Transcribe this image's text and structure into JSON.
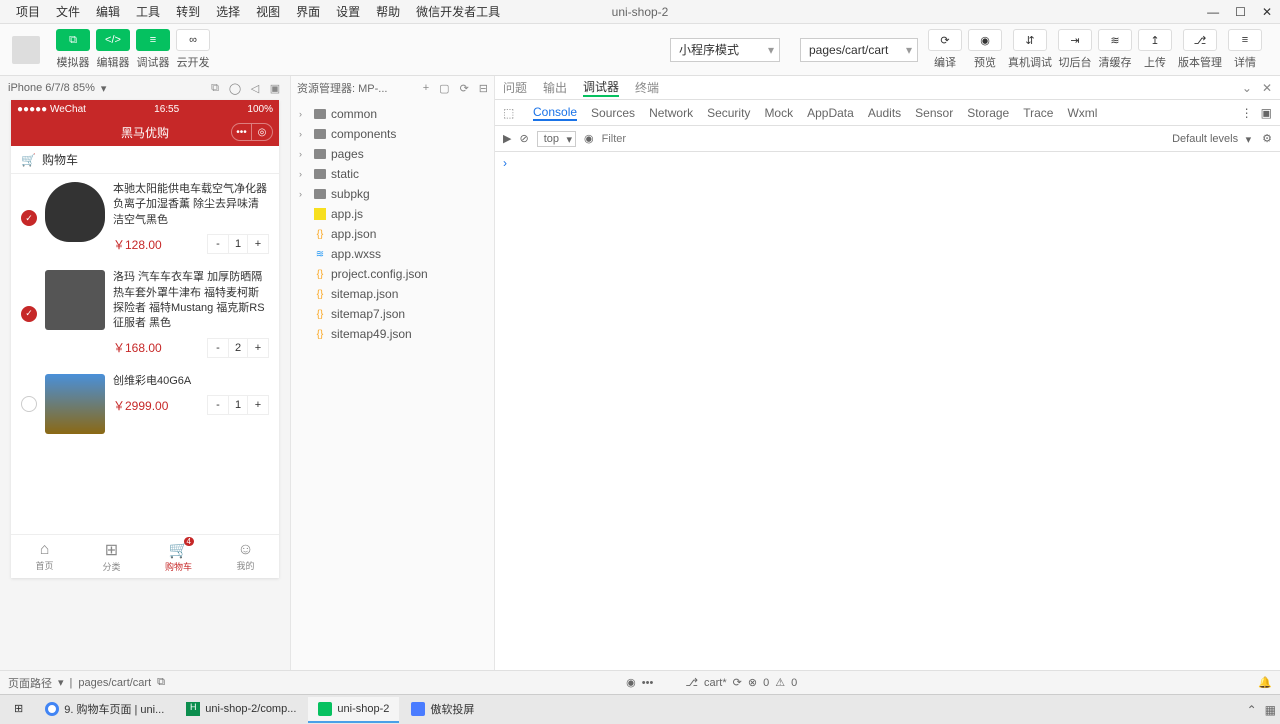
{
  "window": {
    "title": "uni-shop-2",
    "menu": [
      "项目",
      "文件",
      "编辑",
      "工具",
      "转到",
      "选择",
      "视图",
      "界面",
      "设置",
      "帮助",
      "微信开发者工具"
    ]
  },
  "toolbar": {
    "buttons": [
      {
        "label": "模拟器",
        "glyph": "⧉"
      },
      {
        "label": "编辑器",
        "glyph": "</>"
      },
      {
        "label": "调试器",
        "glyph": "≡"
      },
      {
        "label": "云开发",
        "glyph": "∞"
      }
    ],
    "mode_select": "小程序模式",
    "page_select": "pages/cart/cart",
    "actions": [
      {
        "label": "编译",
        "glyph": "⟳"
      },
      {
        "label": "预览",
        "glyph": "◉"
      },
      {
        "label": "真机调试",
        "glyph": "⇵"
      },
      {
        "label": "切后台",
        "glyph": "⇥"
      },
      {
        "label": "清缓存",
        "glyph": "≋"
      }
    ],
    "right_actions": [
      {
        "label": "上传",
        "glyph": "↥"
      },
      {
        "label": "版本管理",
        "glyph": "⎇"
      },
      {
        "label": "详情",
        "glyph": "≡"
      }
    ]
  },
  "simulator": {
    "device": "iPhone 6/7/8 85%",
    "status": {
      "left": "●●●●● WeChat",
      "time": "16:55",
      "right": "100%"
    },
    "nav_title": "黑马优购",
    "cart_header": "购物车",
    "items": [
      {
        "checked": true,
        "name": "本驰太阳能供电车载空气净化器负离子加湿香薰 除尘去异味清洁空气黑色",
        "price": "￥128.00",
        "qty": "1"
      },
      {
        "checked": true,
        "name": "洛玛 汽车车衣车罩 加厚防晒隔热车套外罩牛津布 福特麦柯斯 探险者 福特Mustang 福克斯RS 征服者 黑色",
        "price": "￥168.00",
        "qty": "2"
      },
      {
        "checked": false,
        "name": "创维彩电40G6A",
        "price": "￥2999.00",
        "qty": "1"
      }
    ],
    "tabs": [
      {
        "label": "首页",
        "glyph": "⌂"
      },
      {
        "label": "分类",
        "glyph": "⊞"
      },
      {
        "label": "购物车",
        "glyph": "🛒",
        "badge": "4",
        "active": true
      },
      {
        "label": "我的",
        "glyph": "☺"
      }
    ]
  },
  "explorer": {
    "title": "资源管理器: MP-...",
    "folders": [
      "common",
      "components",
      "pages",
      "static",
      "subpkg"
    ],
    "files": [
      {
        "name": "app.js",
        "type": "js"
      },
      {
        "name": "app.json",
        "type": "json"
      },
      {
        "name": "app.wxss",
        "type": "wxss"
      },
      {
        "name": "project.config.json",
        "type": "json"
      },
      {
        "name": "sitemap.json",
        "type": "json"
      },
      {
        "name": "sitemap7.json",
        "type": "json"
      },
      {
        "name": "sitemap49.json",
        "type": "json"
      }
    ]
  },
  "devtools": {
    "tabs1": [
      "问题",
      "输出",
      "调试器",
      "终端"
    ],
    "tabs1_active": 2,
    "tabs2": [
      "Console",
      "Sources",
      "Network",
      "Security",
      "Mock",
      "AppData",
      "Audits",
      "Sensor",
      "Storage",
      "Trace",
      "Wxml"
    ],
    "tabs2_active": 0,
    "context": "top",
    "filter_placeholder": "Filter",
    "levels": "Default levels",
    "prompt": "›"
  },
  "statusbar": {
    "left": "页面路径",
    "path": "pages/cart/cart",
    "branch": "cart*",
    "errors": "0",
    "warnings": "0"
  },
  "taskbar": {
    "items": [
      {
        "label": "9. 购物车页面 | uni..."
      },
      {
        "label": "uni-shop-2/comp..."
      },
      {
        "label": "uni-shop-2",
        "active": true
      },
      {
        "label": "傲软投屏"
      }
    ]
  }
}
